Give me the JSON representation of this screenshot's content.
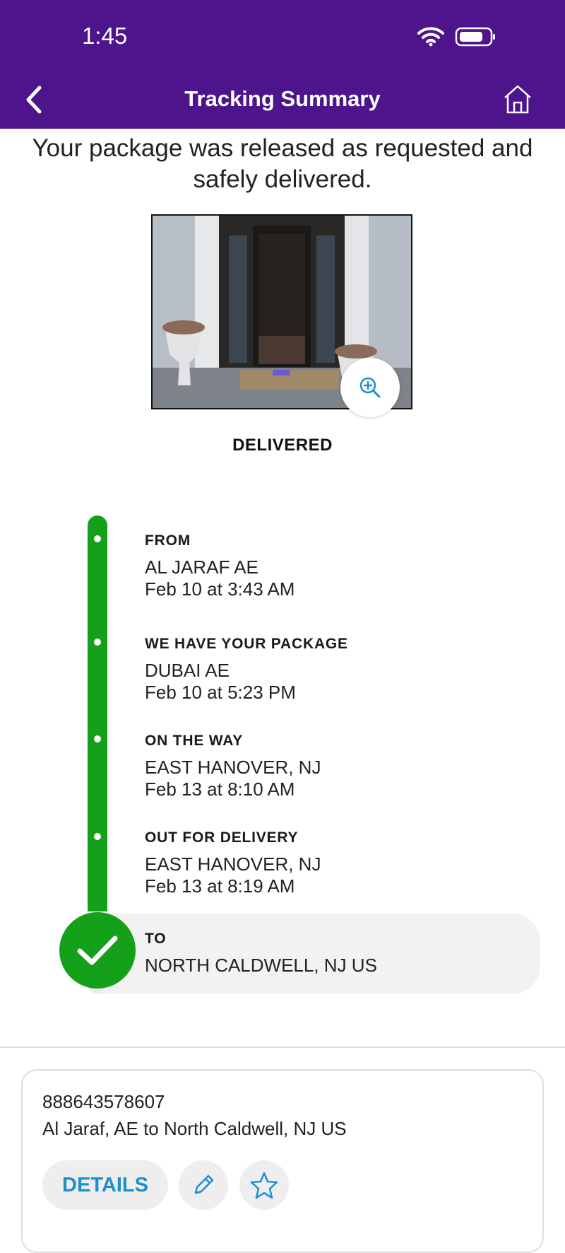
{
  "status_bar": {
    "time": "1:45"
  },
  "header": {
    "title": "Tracking Summary"
  },
  "headline": {
    "line1": "Your package was released as requested and",
    "line2": "safely delivered."
  },
  "status": "DELIVERED",
  "timeline": [
    {
      "label": "FROM",
      "location": "AL JARAF AE",
      "time": "Feb 10 at 3:43 AM"
    },
    {
      "label": "WE HAVE YOUR PACKAGE",
      "location": "DUBAI AE",
      "time": "Feb 10 at 5:23 PM"
    },
    {
      "label": "ON THE WAY",
      "location": "EAST HANOVER, NJ",
      "time": "Feb 13 at 8:10 AM"
    },
    {
      "label": "OUT FOR DELIVERY",
      "location": "EAST HANOVER, NJ",
      "time": "Feb 13 at 8:19 AM"
    },
    {
      "label": "TO",
      "location": "NORTH CALDWELL, NJ  US"
    }
  ],
  "summary": {
    "tracking_number": "888643578607",
    "route": "Al Jaraf, AE to North Caldwell, NJ US",
    "details_label": "DETAILS"
  },
  "icons": {
    "back": "chevron-left-icon",
    "home": "home-icon",
    "zoom": "zoom-in-icon",
    "edit": "pencil-icon",
    "favorite": "star-icon",
    "check": "checkmark-icon"
  },
  "colors": {
    "brand_purple": "#4d148c",
    "progress_green": "#14a019",
    "link_blue": "#1b8fd0"
  }
}
